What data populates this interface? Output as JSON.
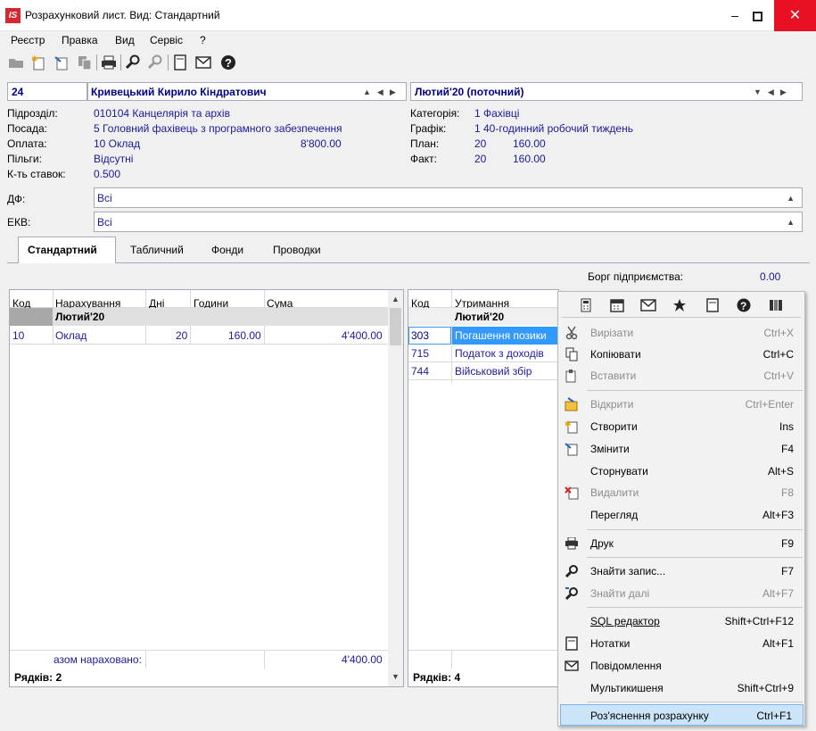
{
  "window": {
    "title": "Розрахунковий лист. Вид: Стандартний",
    "app_icon": "IS"
  },
  "menu": [
    "Реєстр",
    "Правка",
    "Вид",
    "Сервіс",
    "?"
  ],
  "toolbar_icons": [
    "folder-icon",
    "new-doc-icon",
    "edit-doc-icon",
    "copy-icon",
    "print-icon",
    "search-icon",
    "search-next-icon",
    "note-icon",
    "mail-icon",
    "help-icon"
  ],
  "header": {
    "code": "24",
    "employee": "Кривецький Кирило Кіндратович",
    "period": "Лютий'20 (поточний)"
  },
  "info_left": {
    "subdivision_label": "Підрозділ:",
    "subdivision_value": "010104  Канцелярія та архів",
    "position_label": "Посада:",
    "position_value": "5  Головний фахівець з програмного забезпечення",
    "payment_label": "Оплата:",
    "payment_value": "10 Оклад",
    "payment_amount": "8'800.00",
    "benefits_label": "Пільги:",
    "benefits_value": "Відсутні",
    "rates_label": "К-ть ставок:",
    "rates_value": "0.500"
  },
  "info_right": {
    "category_label": "Категорія:",
    "category_value": "1  Фахівці",
    "schedule_label": "Графік:",
    "schedule_value": "1  40-годинний робочий тиждень",
    "plan_label": "План:",
    "plan_days": "20",
    "plan_hours": "160.00",
    "fact_label": "Факт:",
    "fact_days": "20",
    "fact_hours": "160.00"
  },
  "filters": {
    "df_label": "ДФ:",
    "df_value": "Всі",
    "ekv_label": "ЕКВ:",
    "ekv_value": "Всі"
  },
  "tabs": [
    "Стандартний",
    "Табличний",
    "Фонди",
    "Проводки"
  ],
  "debt": {
    "label": "Борг підприємства:",
    "value": "0.00"
  },
  "accruals": {
    "columns": [
      "Код",
      "Нарахування",
      "Дні",
      "Години",
      "Сума"
    ],
    "group": "Лютий'20",
    "rows": [
      {
        "code": "10",
        "name": "Оклад",
        "days": "20",
        "hours": "160.00",
        "sum": "4'400.00"
      }
    ],
    "total_label": "азом нараховано:",
    "total_value": "4'400.00",
    "row_count": "Рядків: 2"
  },
  "deductions": {
    "columns": [
      "Код",
      "Утримання"
    ],
    "group": "Лютий'20",
    "rows": [
      {
        "code": "303",
        "name": "Погашення позики"
      },
      {
        "code": "715",
        "name": "Податок з доходів"
      },
      {
        "code": "744",
        "name": "Військовий збір"
      }
    ],
    "row_count": "Рядків: 4"
  },
  "context_menu": {
    "toolbar": [
      "calculator-icon",
      "calendar-icon",
      "mail-icon",
      "star-icon",
      "note-icon",
      "help-icon",
      "columns-icon"
    ],
    "items": [
      {
        "label": "Вирізати",
        "shortcut": "Ctrl+X",
        "icon": "scissors-icon",
        "disabled": true
      },
      {
        "label": "Копіювати",
        "shortcut": "Ctrl+C",
        "icon": "copy-icon",
        "disabled": false
      },
      {
        "label": "Вставити",
        "shortcut": "Ctrl+V",
        "icon": "paste-icon",
        "disabled": true
      },
      {
        "label": "Відкрити",
        "shortcut": "Ctrl+Enter",
        "icon": "open-icon",
        "disabled": true
      },
      {
        "label": "Створити",
        "shortcut": "Ins",
        "icon": "new-icon",
        "disabled": false
      },
      {
        "label": "Змінити",
        "shortcut": "F4",
        "icon": "edit-icon",
        "disabled": false
      },
      {
        "label": "Сторнувати",
        "shortcut": "Alt+S",
        "icon": "",
        "disabled": false
      },
      {
        "label": "Видалити",
        "shortcut": "F8",
        "icon": "delete-icon",
        "disabled": true
      },
      {
        "label": "Перегляд",
        "shortcut": "Alt+F3",
        "icon": "",
        "disabled": false
      },
      {
        "label": "Друк",
        "shortcut": "F9",
        "icon": "print-icon",
        "disabled": false
      },
      {
        "label": "Знайти запис...",
        "shortcut": "F7",
        "icon": "search-icon",
        "disabled": false
      },
      {
        "label": "Знайти далі",
        "shortcut": "Alt+F7",
        "icon": "search-next-icon",
        "disabled": true
      },
      {
        "label": "SQL редактор",
        "shortcut": "Shift+Ctrl+F12",
        "icon": "",
        "disabled": false
      },
      {
        "label": "Нотатки",
        "shortcut": "Alt+F1",
        "icon": "note-icon",
        "disabled": false
      },
      {
        "label": "Повідомлення",
        "shortcut": "",
        "icon": "mail-icon",
        "disabled": false
      },
      {
        "label": "Мультикишеня",
        "shortcut": "Shift+Ctrl+9",
        "icon": "",
        "disabled": false
      },
      {
        "label": "Роз'яснення розрахунку",
        "shortcut": "Ctrl+F1",
        "icon": "",
        "disabled": false,
        "highlighted": true
      }
    ]
  },
  "colors": {
    "accent_blue": "#1a1a9c",
    "selection": "#3399ff",
    "close_red": "#e81123"
  }
}
